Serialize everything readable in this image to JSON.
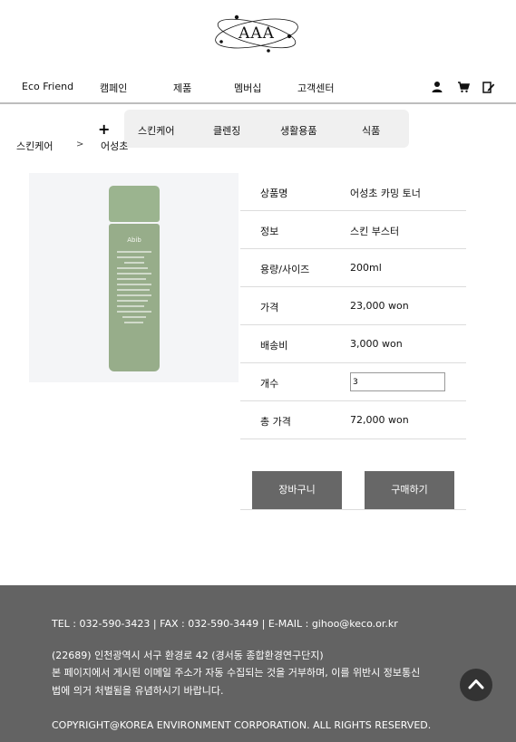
{
  "logo": {
    "text": "AAA"
  },
  "nav": {
    "items": [
      "Eco Friend",
      "캠페인",
      "제품",
      "멤버십",
      "고객센터"
    ],
    "icons": [
      "user-icon",
      "cart-icon",
      "edit-icon"
    ]
  },
  "submenu": {
    "items": [
      "스킨케어",
      "클렌징",
      "생활용품",
      "식품"
    ]
  },
  "plus_symbol": "+",
  "breadcrumb": {
    "category": "스킨케어",
    "separator": ">",
    "current": "어성초"
  },
  "product": {
    "image": {
      "brand": "Abib",
      "color": "#97ad8a"
    },
    "rows": [
      {
        "label": "상품명",
        "value": "어성초 카밍 토너"
      },
      {
        "label": "정보",
        "value": "스킨 부스터"
      },
      {
        "label": "용량/사이즈",
        "value": "200ml"
      },
      {
        "label": "가격",
        "value": "23,000 won"
      },
      {
        "label": "배송비",
        "value": "3,000 won"
      },
      {
        "label": "개수",
        "value": "3"
      },
      {
        "label": "총 가격",
        "value": "72,000 won"
      }
    ]
  },
  "buttons": {
    "cart": "장바구니",
    "buy": "구매하기"
  },
  "footer": {
    "contact": "TEL : 032-590-3423 | FAX : 032-590-3449 | E-MAIL : gihoo@keco.or.kr",
    "address": "(22689) 인천광역시 서구 환경로 42 (경서동 종합환경연구단지)",
    "notice_line1": "본 페이지에서 게시된 이메일 주소가 자동 수집되는 것을 거부하며, 이를 위반시 정보통신",
    "notice_line2": "법에 의거 처벌됨을 유념하시기 바랍니다.",
    "copyright": "COPYRIGHT@KOREA ENVIRONMENT CORPORATION. ALL RIGHTS RESERVED.",
    "background": "#636363"
  }
}
